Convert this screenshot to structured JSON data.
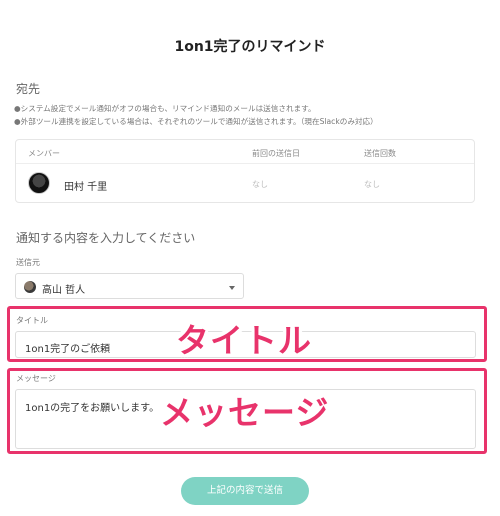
{
  "page_title": "1on1完了のリマインド",
  "recipients": {
    "heading": "宛先",
    "notes": [
      "●システム設定でメール通知がオフの場合も、リマインド通知のメールは送信されます。",
      "●外部ツール連携を設定している場合は、それぞれのツールで通知が送信されます。（現在Slackのみ対応）"
    ],
    "table": {
      "headers": [
        "メンバー",
        "前回の送信日",
        "送信回数"
      ],
      "rows": [
        {
          "name": "田村 千里",
          "last_sent": "なし",
          "count": "なし"
        }
      ]
    }
  },
  "content": {
    "heading": "通知する内容を入力してください",
    "sender_label": "送信元",
    "sender_value": "高山 哲人",
    "title_label": "タイトル",
    "title_value": "1on1完了のご依頼",
    "message_label": "メッセージ",
    "message_value": "1on1の完了をお願いします。"
  },
  "annotations": {
    "title_callout": "タイトル",
    "message_callout": "メッセージ",
    "color": "#e8336b"
  },
  "submit_label": "上記の内容で送信",
  "colors": {
    "accent": "#7fd3c4",
    "highlight": "#e8336b"
  }
}
